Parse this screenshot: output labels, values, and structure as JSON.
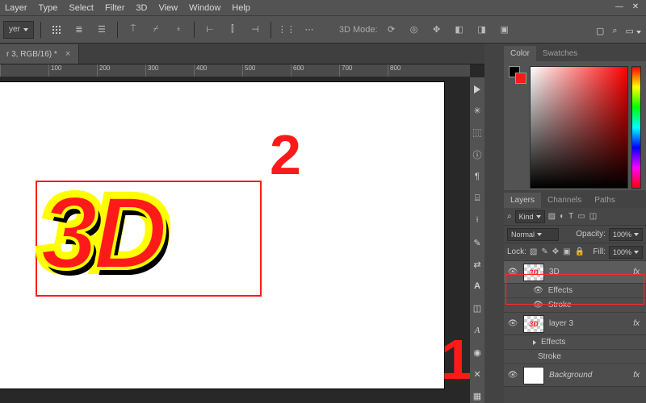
{
  "menu": {
    "items": [
      "Layer",
      "Type",
      "Select",
      "Filter",
      "3D",
      "View",
      "Window",
      "Help"
    ]
  },
  "optionsbar": {
    "layer_dd": "yer",
    "mode_3d": "3D Mode:"
  },
  "doc_tab": {
    "title": "r 3, RGB/16) *",
    "close": "×"
  },
  "ruler": {
    "marks": [
      "",
      "100",
      "200",
      "300",
      "400",
      "500",
      "600",
      "700",
      "800"
    ]
  },
  "canvas": {
    "art_text": "3D"
  },
  "annotations": {
    "one": "1",
    "two": "2"
  },
  "color_panel": {
    "tabs": [
      "Color",
      "Swatches"
    ]
  },
  "layers_panel": {
    "tabs": [
      "Layers",
      "Channels",
      "Paths"
    ],
    "kind_label": "Kind",
    "blend": "Normal",
    "opacity_label": "Opacity:",
    "opacity_value": "100%",
    "lock_label": "Lock:",
    "fill_label": "Fill:",
    "fill_value": "100%",
    "layers": [
      {
        "name": "3D",
        "thumb": "3D",
        "fx": "fx",
        "sub": [
          "Effects",
          "Stroke"
        ]
      },
      {
        "name": "layer 3",
        "thumb": "3D",
        "fx": "fx",
        "sub": [
          "Effects",
          "Stroke"
        ]
      },
      {
        "name": "Background",
        "thumb": "",
        "fx": "fx"
      }
    ]
  },
  "icons": {
    "search": "⌕",
    "eye": "👁",
    "lock": "🔒",
    "square": "□",
    "frame": "▣"
  }
}
